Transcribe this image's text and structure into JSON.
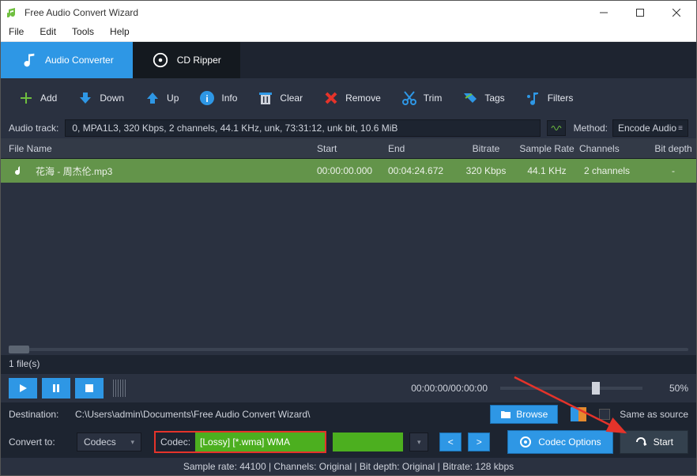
{
  "titlebar": {
    "title": "Free Audio Convert Wizard"
  },
  "menubar": {
    "file": "File",
    "edit": "Edit",
    "tools": "Tools",
    "help": "Help"
  },
  "tabs": {
    "converter": "Audio Converter",
    "ripper": "CD Ripper"
  },
  "toolbar": {
    "add": "Add",
    "down": "Down",
    "up": "Up",
    "info": "Info",
    "clear": "Clear",
    "remove": "Remove",
    "trim": "Trim",
    "tags": "Tags",
    "filters": "Filters"
  },
  "audio_track": {
    "label": "Audio track:",
    "value": "0, MPA1L3, 320 Kbps, 2 channels, 44.1 KHz, unk, 73:31:12, unk bit, 10.6 MiB",
    "method_label": "Method:",
    "method_value": "Encode Audio"
  },
  "columns": {
    "name": "File Name",
    "start": "Start",
    "end": "End",
    "bitrate": "Bitrate",
    "sample": "Sample Rate",
    "channels": "Channels",
    "depth": "Bit depth"
  },
  "files": [
    {
      "name": "花海 - 周杰伦.mp3",
      "start": "00:00:00.000",
      "end": "00:04:24.672",
      "bitrate": "320 Kbps",
      "sample": "44.1 KHz",
      "channels": "2 channels",
      "depth": "-"
    }
  ],
  "file_count": "1 file(s)",
  "player": {
    "time": "00:00:00/00:00:00",
    "pct": "50%"
  },
  "destination": {
    "label": "Destination:",
    "path": "C:\\Users\\admin\\Documents\\Free Audio Convert Wizard\\",
    "browse": "Browse",
    "same": "Same as source"
  },
  "convert": {
    "label": "Convert to:",
    "group": "Codecs",
    "codec_label": "Codec:",
    "codec_value": "[Lossy] [*.wma] WMA",
    "prev": "<",
    "next": ">",
    "options": "Codec Options",
    "start": "Start"
  },
  "status": "Sample rate: 44100 | Channels: Original | Bit depth: Original | Bitrate: 128 kbps"
}
